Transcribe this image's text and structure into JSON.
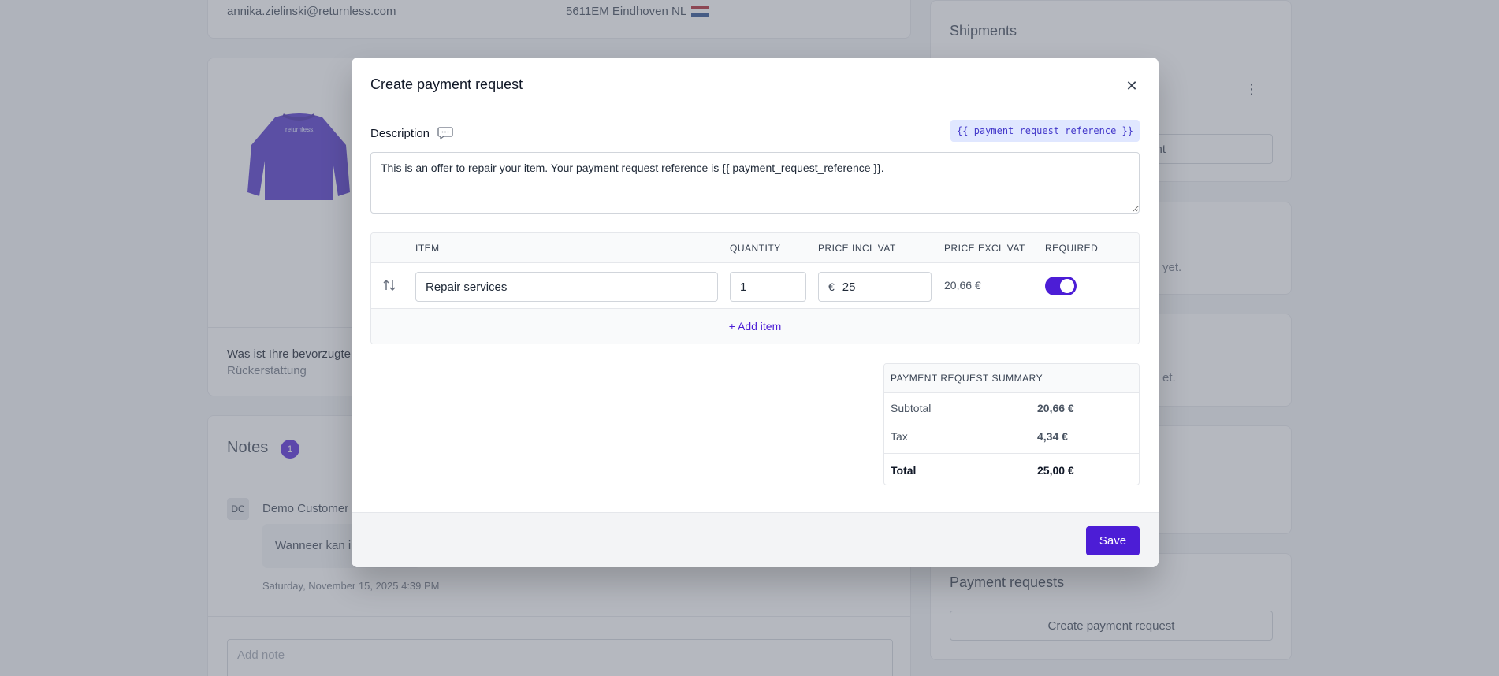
{
  "background": {
    "customer": {
      "email": "annika.zielinski@returnless.com",
      "postal": "5611EM Eindhoven NL"
    },
    "product_card": {
      "question": "Was ist Ihre bevorzugte",
      "answer": "Rückerstattung"
    },
    "notes": {
      "title": "Notes",
      "count": "1",
      "author_initials": "DC",
      "author_name": "Demo Customer",
      "message": "Wanneer kan i",
      "timestamp": "Saturday, November 15, 2025 4:39 PM",
      "add_note_placeholder": "Add note"
    },
    "sidebar": {
      "shipments_title": "Shipments",
      "shipments_button": "nt",
      "text_1": "yet.",
      "text_2": "et.",
      "payment_requests_title": "Payment requests",
      "create_payment_request_button": "Create payment request"
    }
  },
  "modal": {
    "title": "Create payment request",
    "description_label": "Description",
    "variable_chip": "{{ payment_request_reference }}",
    "description_value": "This is an offer to repair your item. Your payment request reference is {{ payment_request_reference }}.",
    "table": {
      "headers": {
        "item": "ITEM",
        "quantity": "QUANTITY",
        "price_incl": "PRICE INCL VAT",
        "price_excl": "PRICE EXCL VAT",
        "required": "REQUIRED"
      },
      "rows": [
        {
          "item": "Repair services",
          "quantity": "1",
          "currency": "€",
          "price_incl": "25",
          "price_excl": "20,66 €",
          "required": true
        }
      ],
      "add_item_label": "+ Add item"
    },
    "summary": {
      "title": "PAYMENT REQUEST SUMMARY",
      "subtotal_label": "Subtotal",
      "subtotal_value": "20,66 €",
      "tax_label": "Tax",
      "tax_value": "4,34 €",
      "total_label": "Total",
      "total_value": "25,00 €"
    },
    "save_label": "Save"
  },
  "colors": {
    "accent": "#4c1dd6",
    "chip_bg": "#e0e7ff",
    "overlay": "rgba(107,114,128,0.5)"
  }
}
